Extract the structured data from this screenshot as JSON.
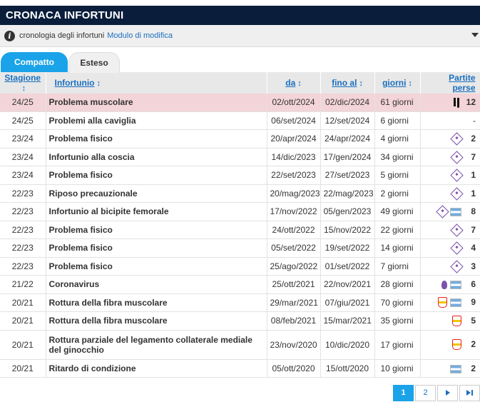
{
  "header": {
    "title": "CRONACA INFORTUNI"
  },
  "info": {
    "text": "cronologia degli infortuni",
    "link": "Modulo di modifica",
    "icon": "info-icon"
  },
  "tabs": [
    {
      "label": "Compatto",
      "active": true
    },
    {
      "label": "Esteso",
      "active": false
    }
  ],
  "columns": {
    "season": "Stagione",
    "injury": "Infortunio",
    "from": "da",
    "until": "fino al",
    "days": "giorni",
    "games": "Partite perse",
    "sort_icon": "↕"
  },
  "rows": [
    {
      "season": "24/25",
      "injury": "Problema muscolare",
      "from": "02/ott/2024",
      "until": "02/dic/2024",
      "days": "61 giorni",
      "clubs": [
        "juventus"
      ],
      "games": "12",
      "highlight": true
    },
    {
      "season": "24/25",
      "injury": "Problemi alla caviglia",
      "from": "06/set/2024",
      "until": "12/set/2024",
      "days": "6 giorni",
      "clubs": [],
      "games": "-"
    },
    {
      "season": "23/24",
      "injury": "Problema fisico",
      "from": "20/apr/2024",
      "until": "24/apr/2024",
      "days": "4 giorni",
      "clubs": [
        "fiorentina"
      ],
      "games": "2"
    },
    {
      "season": "23/24",
      "injury": "Infortunio alla coscia",
      "from": "14/dic/2023",
      "until": "17/gen/2024",
      "days": "34 giorni",
      "clubs": [
        "fiorentina"
      ],
      "games": "7"
    },
    {
      "season": "23/24",
      "injury": "Problema fisico",
      "from": "22/set/2023",
      "until": "27/set/2023",
      "days": "5 giorni",
      "clubs": [
        "fiorentina"
      ],
      "games": "1"
    },
    {
      "season": "22/23",
      "injury": "Riposo precauzionale",
      "from": "20/mag/2023",
      "until": "22/mag/2023",
      "days": "2 giorni",
      "clubs": [
        "fiorentina"
      ],
      "games": "1"
    },
    {
      "season": "22/23",
      "injury": "Infortunio al bicipite femorale",
      "from": "17/nov/2022",
      "until": "05/gen/2023",
      "days": "49 giorni",
      "clubs": [
        "fiorentina",
        "argentina"
      ],
      "games": "8"
    },
    {
      "season": "22/23",
      "injury": "Problema fisico",
      "from": "24/ott/2022",
      "until": "15/nov/2022",
      "days": "22 giorni",
      "clubs": [
        "fiorentina"
      ],
      "games": "7"
    },
    {
      "season": "22/23",
      "injury": "Problema fisico",
      "from": "05/set/2022",
      "until": "19/set/2022",
      "days": "14 giorni",
      "clubs": [
        "fiorentina"
      ],
      "games": "4"
    },
    {
      "season": "22/23",
      "injury": "Problema fisico",
      "from": "25/ago/2022",
      "until": "01/set/2022",
      "days": "7 giorni",
      "clubs": [
        "fiorentina"
      ],
      "games": "3"
    },
    {
      "season": "21/22",
      "injury": "Coronavirus",
      "from": "25/ott/2021",
      "until": "22/nov/2021",
      "days": "28 giorni",
      "clubs": [
        "fiorentina-old",
        "argentina"
      ],
      "games": "6"
    },
    {
      "season": "20/21",
      "injury": "Rottura della fibra muscolare",
      "from": "29/mar/2021",
      "until": "07/giu/2021",
      "days": "70 giorni",
      "clubs": [
        "stuttgart",
        "argentina"
      ],
      "games": "9"
    },
    {
      "season": "20/21",
      "injury": "Rottura della fibra muscolare",
      "from": "08/feb/2021",
      "until": "15/mar/2021",
      "days": "35 giorni",
      "clubs": [
        "stuttgart"
      ],
      "games": "5"
    },
    {
      "season": "20/21",
      "injury": "Rottura parziale del legamento collaterale mediale del ginocchio",
      "from": "23/nov/2020",
      "until": "10/dic/2020",
      "days": "17 giorni",
      "clubs": [
        "stuttgart"
      ],
      "games": "2",
      "tall": true
    },
    {
      "season": "20/21",
      "injury": "Ritardo di condizione",
      "from": "05/ott/2020",
      "until": "15/ott/2020",
      "days": "10 giorni",
      "clubs": [
        "argentina"
      ],
      "games": "2"
    }
  ],
  "pagination": {
    "pages": [
      "1",
      "2"
    ],
    "current": "1",
    "next_icon": "next-icon",
    "last_icon": "last-icon"
  },
  "colors": {
    "header_bg": "#0a1e3c",
    "accent": "#1aa3e8",
    "link": "#1a6fc0",
    "highlight_row": "#f3d4d8"
  }
}
